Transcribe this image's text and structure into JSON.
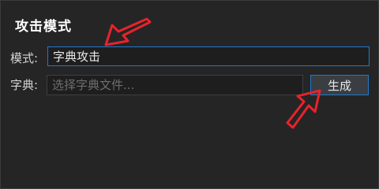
{
  "panel": {
    "title": "攻击模式"
  },
  "form": {
    "mode_label": "模式:",
    "mode_value": "字典攻击",
    "dict_label": "字典:",
    "dict_placeholder": "选择字典文件...",
    "generate_button": "生成"
  },
  "annotations": {
    "arrow_color": "#e8232a"
  }
}
